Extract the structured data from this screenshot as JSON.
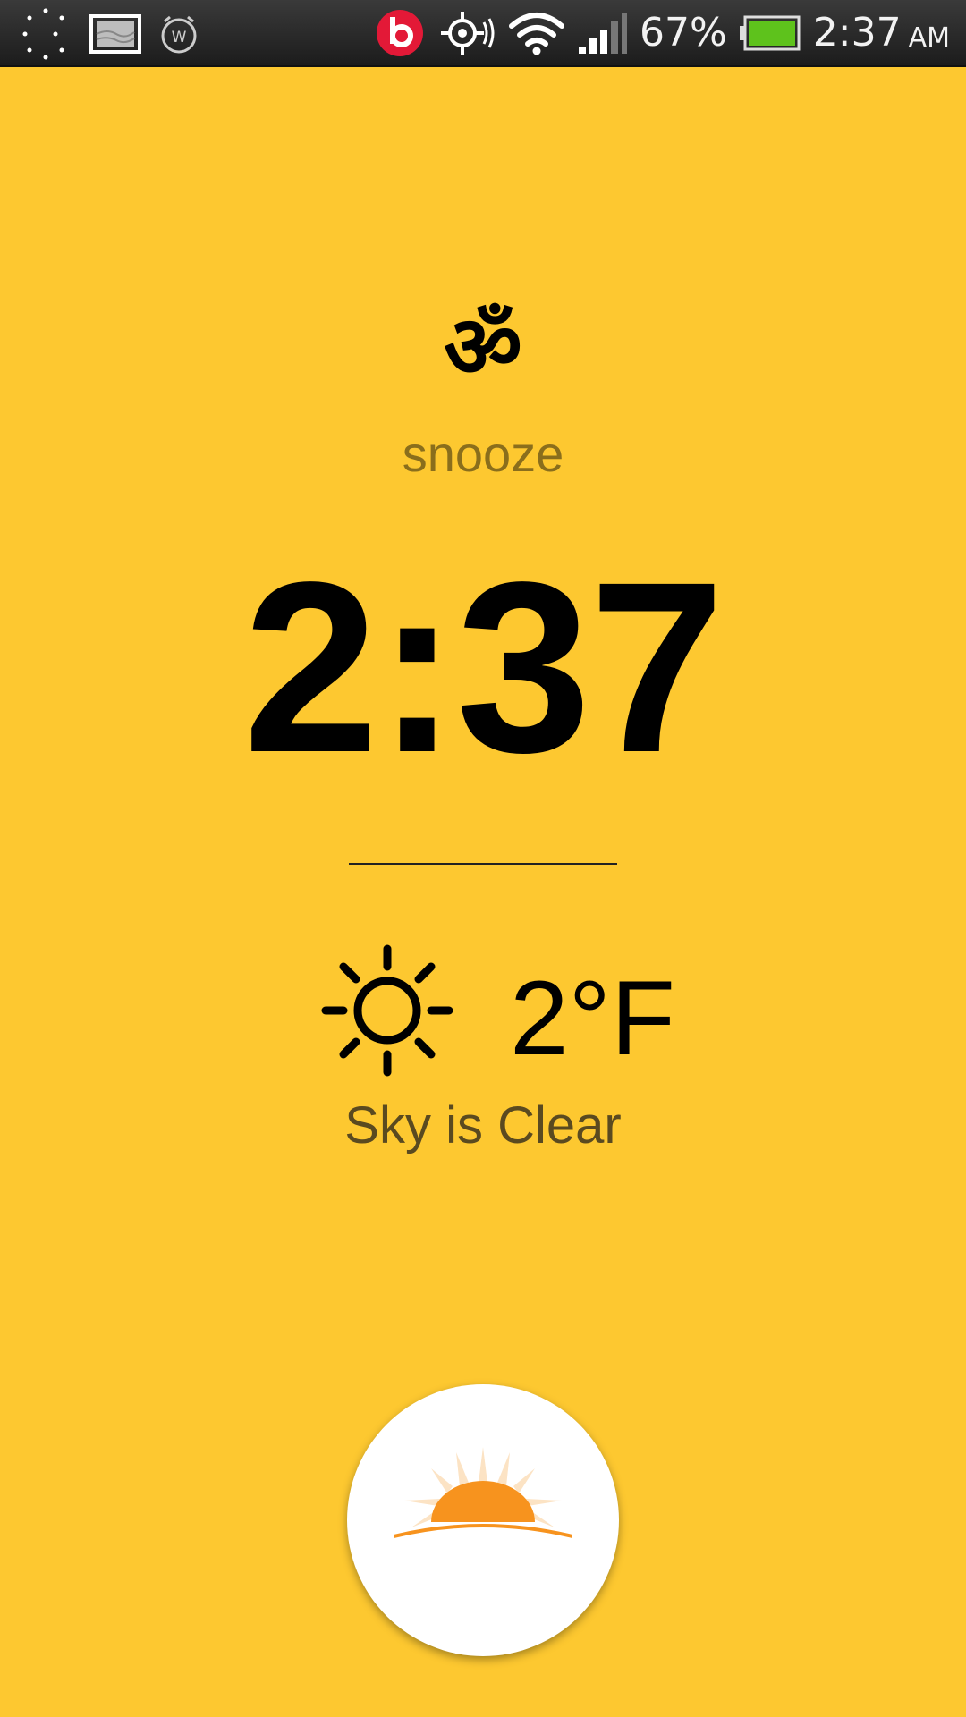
{
  "status_bar": {
    "left_icons": [
      "night-mode-icon",
      "gallery-icon",
      "alarm-w-icon"
    ],
    "right_icons": [
      "beats-audio-icon",
      "gps-icon",
      "wifi-icon",
      "signal-icon",
      "battery-icon"
    ],
    "battery_percent": "67%",
    "battery_level": 0.67,
    "time": "2:37",
    "ampm": "AM"
  },
  "alarm": {
    "symbol": "ॐ",
    "snooze_label": "snooze",
    "time": "2:37"
  },
  "weather": {
    "icon": "sun-icon",
    "temperature": "2°F",
    "condition": "Sky is Clear"
  },
  "dismiss": {
    "icon": "sunrise-icon"
  },
  "colors": {
    "background": "#FDC830",
    "status_bar": "#262626",
    "snooze_text": "#8a6e1c",
    "sunrise_orange": "#F7931E",
    "beats_red": "#E31937",
    "battery_green": "#5ec21c"
  }
}
